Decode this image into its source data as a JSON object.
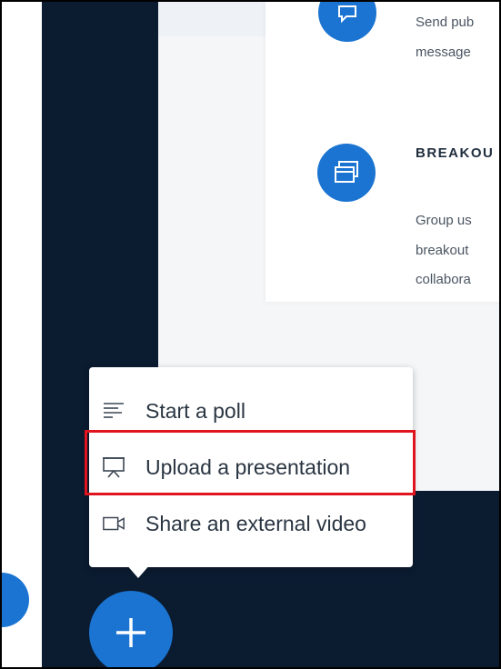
{
  "features": [
    {
      "icon": "message-icon",
      "title": "",
      "lines": [
        "Send pub",
        "message"
      ]
    },
    {
      "icon": "breakout-rooms-icon",
      "title": "BREAKOU",
      "lines": [
        "Group us",
        "breakout",
        "collabora"
      ]
    }
  ],
  "actions_menu": {
    "items": [
      {
        "icon": "poll-icon",
        "label": "Start a poll"
      },
      {
        "icon": "presentation-icon",
        "label": "Upload a presentation",
        "highlighted": true
      },
      {
        "icon": "video-icon",
        "label": "Share an external video"
      }
    ]
  },
  "plus_button": {
    "icon": "plus-icon"
  },
  "colors": {
    "accent": "#1b74d1",
    "dark_background": "#0b1b30",
    "highlight_border": "#e0141e"
  }
}
